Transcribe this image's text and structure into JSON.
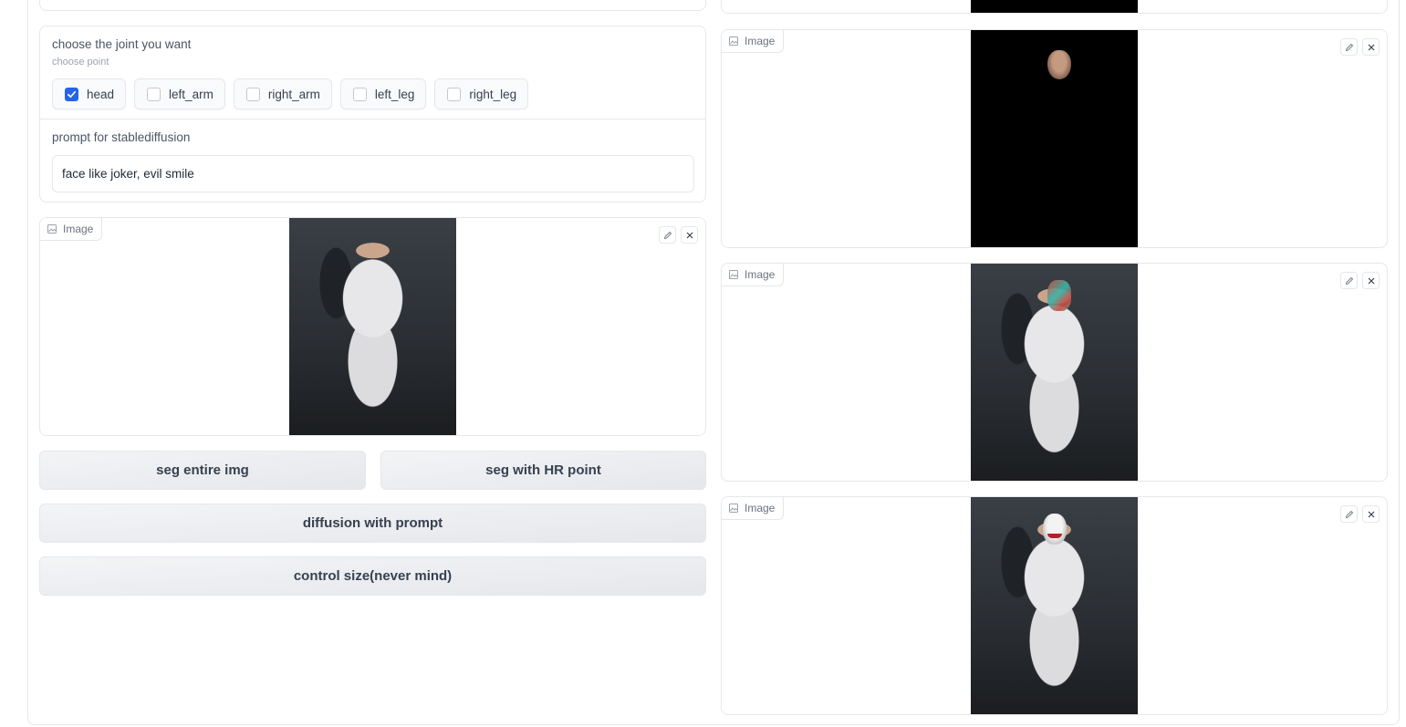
{
  "joint": {
    "label": "choose the joint you want",
    "info": "choose point",
    "options": [
      {
        "label": "head",
        "checked": true
      },
      {
        "label": "left_arm",
        "checked": false
      },
      {
        "label": "right_arm",
        "checked": false
      },
      {
        "label": "left_leg",
        "checked": false
      },
      {
        "label": "right_leg",
        "checked": false
      }
    ]
  },
  "prompt": {
    "label": "prompt for stablediffusion",
    "value": "face like joker, evil smile"
  },
  "input_image": {
    "tag": "Image"
  },
  "buttons": {
    "seg_entire": "seg entire img",
    "seg_hr": "seg with HR point",
    "diffusion": "diffusion with prompt",
    "control_size": "control size(never mind)"
  },
  "outputs": [
    {
      "tag": "Image",
      "content": "head mask"
    },
    {
      "tag": "Image",
      "content": "segmentation overlay"
    },
    {
      "tag": "Image",
      "content": "diffusion result"
    }
  ],
  "colors": {
    "accent": "#2563eb",
    "border": "#e5e7eb"
  }
}
